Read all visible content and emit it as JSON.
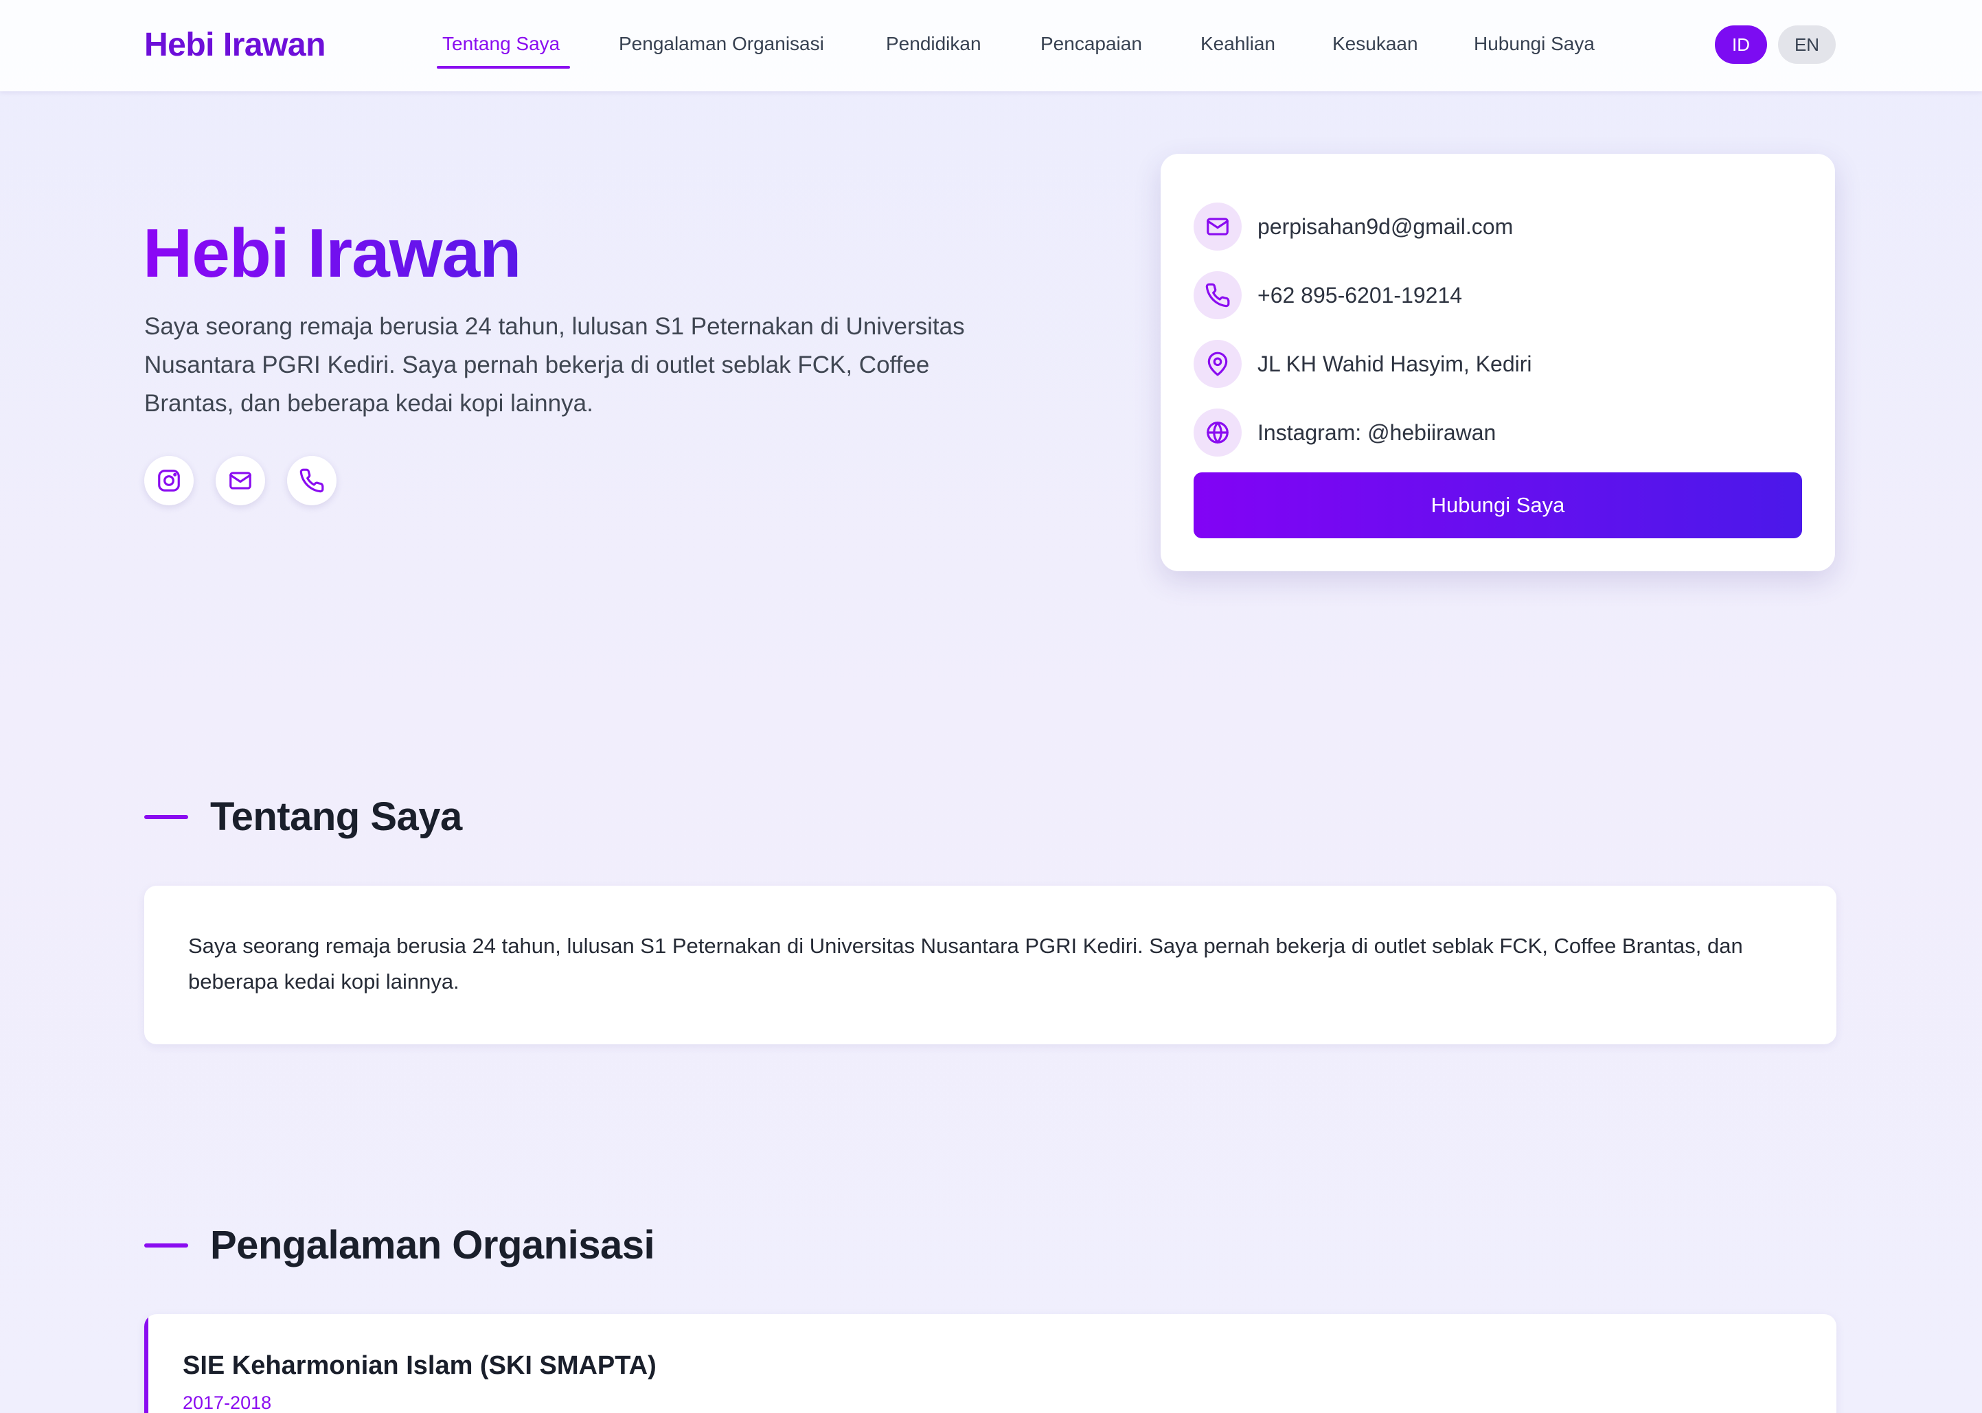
{
  "header": {
    "brand": "Hebi Irawan",
    "nav": [
      {
        "label": "Tentang Saya",
        "active": true
      },
      {
        "label": "Pengalaman Organisasi",
        "active": false
      },
      {
        "label": "Pendidikan",
        "active": false
      },
      {
        "label": "Pencapaian",
        "active": false
      },
      {
        "label": "Keahlian",
        "active": false
      },
      {
        "label": "Kesukaan",
        "active": false
      },
      {
        "label": "Hubungi Saya",
        "active": false
      }
    ],
    "languages": [
      {
        "label": "ID",
        "active": true
      },
      {
        "label": "EN",
        "active": false
      }
    ]
  },
  "hero": {
    "name": "Hebi Irawan",
    "description": "Saya seorang remaja berusia 24 tahun, lulusan S1 Peternakan di Universitas Nusantara PGRI Kediri. Saya pernah bekerja di outlet seblak FCK, Coffee Brantas, dan beberapa kedai kopi lainnya.",
    "social_icons": [
      "instagram-icon",
      "mail-icon",
      "phone-icon"
    ]
  },
  "contact": {
    "items": [
      {
        "icon": "mail-icon",
        "text": "perpisahan9d@gmail.com"
      },
      {
        "icon": "phone-icon",
        "text": "+62 895-6201-19214"
      },
      {
        "icon": "map-pin-icon",
        "text": "JL KH Wahid Hasyim, Kediri"
      },
      {
        "icon": "globe-icon",
        "text": "Instagram: @hebiirawan"
      }
    ],
    "button_label": "Hubungi Saya"
  },
  "about": {
    "title": "Tentang Saya",
    "text": "Saya seorang remaja berusia 24 tahun, lulusan S1 Peternakan di Universitas Nusantara PGRI Kediri. Saya pernah bekerja di outlet seblak FCK, Coffee Brantas, dan beberapa kedai kopi lainnya."
  },
  "experience": {
    "title": "Pengalaman Organisasi",
    "items": [
      {
        "title": "SIE Keharmonian Islam (SKI SMAPTA)",
        "period": "2017-2018"
      }
    ]
  },
  "colors": {
    "accent": "#8a0cf0",
    "accent_dark": "#5a18e8",
    "icon_bg": "#f1e2fb",
    "background": "#ecedfd"
  }
}
